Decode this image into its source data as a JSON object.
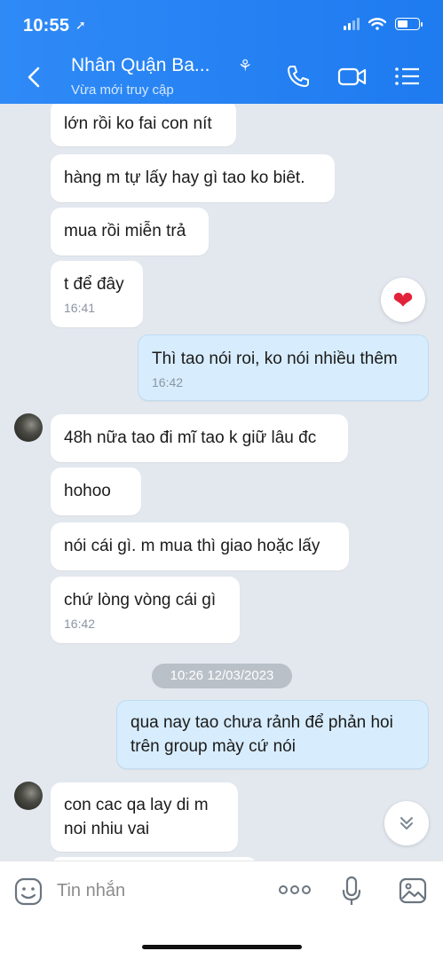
{
  "status_bar": {
    "time": "10:55"
  },
  "header": {
    "contact_name": "Nhân Quận Ba...",
    "status": "Vừa mới truy cập",
    "icons": [
      "back-icon",
      "phone-icon",
      "video-call-icon",
      "menu-icon"
    ]
  },
  "messages": [
    {
      "text": "lớn rồi ko fai con nít"
    },
    {
      "text": "hàng m tự lấy hay gì tao ko biêt."
    },
    {
      "text": "mua rồi miễn trả"
    },
    {
      "text": "t để đây",
      "time": "16:41",
      "reaction": "heart"
    },
    {
      "text": "Thì tao nói roi, ko nói nhiều thêm",
      "time": "16:42"
    },
    {
      "text": "48h nữa tao đi mĩ tao k giữ lâu đc"
    },
    {
      "text": "hohoo"
    },
    {
      "text": "nói cái gì. m mua thì giao hoặc lấy"
    },
    {
      "text": "chứ lòng vòng cái gì",
      "time": "16:42"
    },
    {
      "text": "qua nay tao chưa rảnh để phản hoi trên group mày cứ nói"
    },
    {
      "text": "con cac qa lay di m noi nhiu vai"
    }
  ],
  "date_separator": "10:26 12/03/2023",
  "input": {
    "placeholder": "Tin nhắn"
  },
  "colors": {
    "header": "#1e7bf0",
    "outgoing_bubble": "#d7ecfc",
    "incoming_bubble": "#ffffff",
    "background": "#e3e8ef"
  }
}
